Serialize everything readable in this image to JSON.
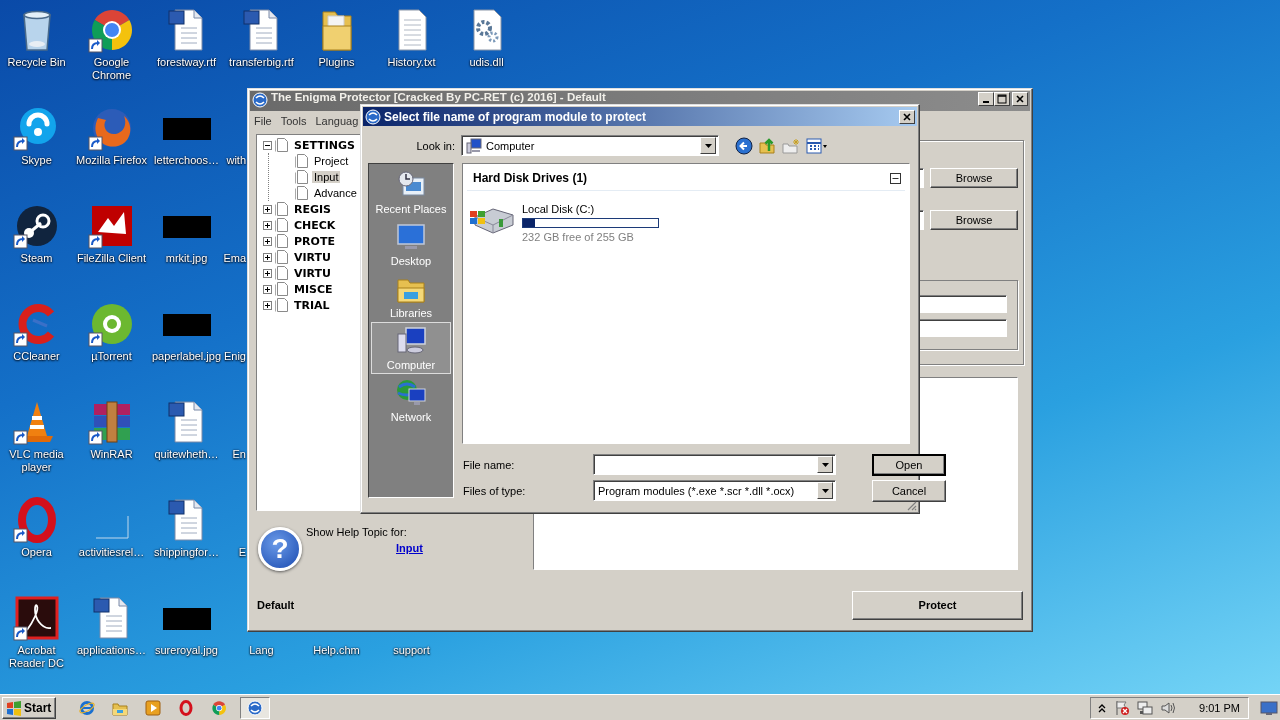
{
  "desktop": {
    "rows": [
      [
        {
          "label": "Recycle Bin",
          "kind": "recycle",
          "shortcut": false
        },
        {
          "label": "Google Chrome",
          "kind": "chrome",
          "shortcut": true
        },
        {
          "label": "forestway.rtf",
          "kind": "word",
          "shortcut": false
        },
        {
          "label": "transferbig.rtf",
          "kind": "word",
          "shortcut": false
        },
        {
          "label": "Plugins",
          "kind": "folder",
          "shortcut": false
        },
        {
          "label": "History.txt",
          "kind": "text",
          "shortcut": false
        },
        {
          "label": "udis.dll",
          "kind": "dll",
          "shortcut": false
        }
      ],
      [
        {
          "label": "Skype",
          "kind": "skype",
          "shortcut": true
        },
        {
          "label": "Mozilla Firefox",
          "kind": "firefox",
          "shortcut": true
        },
        {
          "label": "letterchoos…",
          "kind": "redacted",
          "shortcut": false
        },
        {
          "label": "with",
          "kind": "partial"
        }
      ],
      [
        {
          "label": "Steam",
          "kind": "steam",
          "shortcut": true
        },
        {
          "label": "FileZilla Client",
          "kind": "filezilla",
          "shortcut": true
        },
        {
          "label": "mrkit.jpg",
          "kind": "redacted",
          "shortcut": false
        },
        {
          "label": "Ema",
          "kind": "partial"
        }
      ],
      [
        {
          "label": "CCleaner",
          "kind": "ccleaner",
          "shortcut": true
        },
        {
          "label": "µTorrent",
          "kind": "utorrent",
          "shortcut": true
        },
        {
          "label": "paperlabel.jpg",
          "kind": "redacted",
          "shortcut": false
        },
        {
          "label": "Enig",
          "kind": "partial"
        }
      ],
      [
        {
          "label": "VLC media player",
          "kind": "vlc",
          "shortcut": true
        },
        {
          "label": "WinRAR",
          "kind": "winrar",
          "shortcut": true
        },
        {
          "label": "quitewheth…",
          "kind": "word",
          "shortcut": false
        },
        {
          "label": "En",
          "kind": "partial"
        }
      ],
      [
        {
          "label": "Opera",
          "kind": "opera",
          "shortcut": true
        },
        {
          "label": "activitiesrel…",
          "kind": "blank",
          "shortcut": false
        },
        {
          "label": "shippingfor…",
          "kind": "word",
          "shortcut": false
        },
        {
          "label": "E",
          "kind": "partial"
        }
      ],
      [
        {
          "label": "Acrobat Reader DC",
          "kind": "acrobat",
          "shortcut": true
        },
        {
          "label": "applications…",
          "kind": "word",
          "shortcut": false
        },
        {
          "label": "sureroyal.jpg",
          "kind": "redacted",
          "shortcut": false
        },
        {
          "label": "Lang",
          "kind": "covered"
        },
        {
          "label": "Help.chm",
          "kind": "covered"
        },
        {
          "label": "support",
          "kind": "covered"
        }
      ]
    ]
  },
  "main_window": {
    "title": "The Enigma Protector [Cracked By PC-RET (c) 2016] - Default",
    "menu": [
      "File",
      "Tools",
      "Languag"
    ],
    "tree": [
      {
        "label": "SETTINGS",
        "expanded": true,
        "selected": false,
        "children": [
          {
            "label": "Project",
            "selected": false
          },
          {
            "label": "Input",
            "selected": true
          },
          {
            "label": "Advance",
            "selected": false
          }
        ]
      },
      {
        "label": "REGIS",
        "expanded": false,
        "selected": false
      },
      {
        "label": "CHECK",
        "expanded": false,
        "selected": false
      },
      {
        "label": "PROTE",
        "expanded": false,
        "selected": false
      },
      {
        "label": "VIRTU",
        "expanded": false,
        "selected": false
      },
      {
        "label": "VIRTU",
        "expanded": false,
        "selected": false
      },
      {
        "label": "MISCE",
        "expanded": false,
        "selected": false
      },
      {
        "label": "TRIAL",
        "expanded": false,
        "selected": false
      }
    ],
    "browse_buttons": [
      "Browse",
      "Browse"
    ],
    "help": {
      "glyph": "?",
      "caption": "Show Help Topic for:",
      "link": "Input"
    },
    "profile": "Default",
    "protect_button": "Protect"
  },
  "dialog": {
    "title": "Select file name of program module to protect",
    "look_in": {
      "label": "Look in:",
      "value": "Computer"
    },
    "places": [
      {
        "label": "Recent Places",
        "kind": "recent",
        "selected": false
      },
      {
        "label": "Desktop",
        "kind": "desktop",
        "selected": false
      },
      {
        "label": "Libraries",
        "kind": "libraries",
        "selected": false
      },
      {
        "label": "Computer",
        "kind": "computer",
        "selected": true
      },
      {
        "label": "Network",
        "kind": "network",
        "selected": false
      }
    ],
    "group": {
      "title": "Hard Disk Drives (1)",
      "expanded": true,
      "drives": [
        {
          "name": "Local Disk (C:)",
          "level": 0.09,
          "free": "232 GB free of 255 GB"
        }
      ]
    },
    "file_name": {
      "label": "File name:"
    },
    "file_type": {
      "label": "Files of type:",
      "value": "Program modules (*.exe *.scr *.dll *.ocx)"
    },
    "buttons": [
      {
        "label": "Open",
        "default": true
      },
      {
        "label": "Cancel",
        "default": false
      }
    ]
  },
  "taskbar": {
    "start": "Start",
    "apps": [
      {
        "kind": "ie",
        "selected": false
      },
      {
        "kind": "explorer",
        "selected": false
      },
      {
        "kind": "media",
        "selected": false
      },
      {
        "kind": "opera",
        "selected": false
      },
      {
        "kind": "chrome",
        "selected": false
      },
      {
        "kind": "enigma",
        "selected": true
      }
    ],
    "clock": "9:01 PM"
  }
}
